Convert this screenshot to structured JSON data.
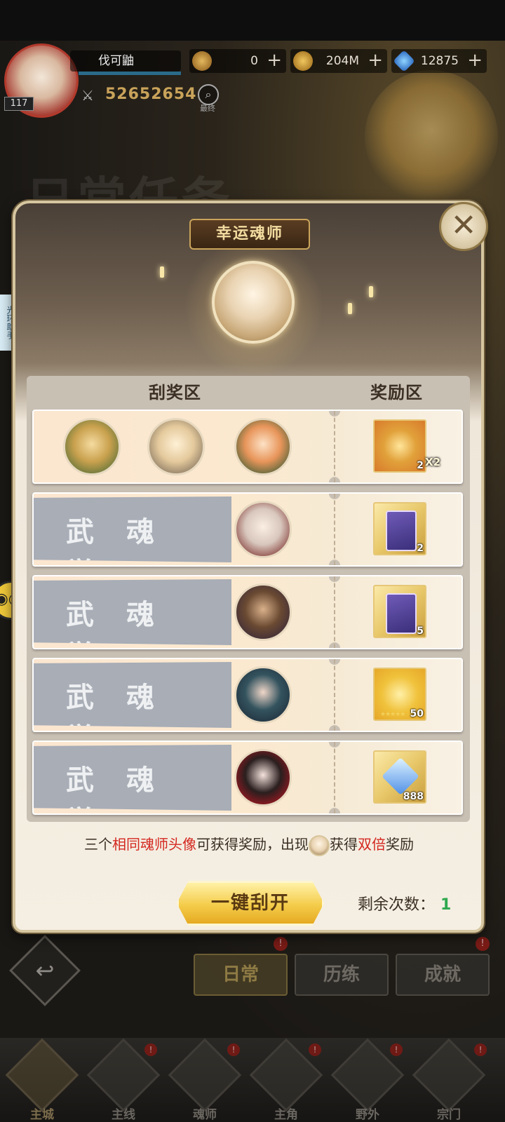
{
  "hud": {
    "player_name": "伐可鼬",
    "level": "117",
    "power": "52652654",
    "search_label": "最终",
    "resources": [
      {
        "icon": "soul-coin-icon",
        "value": "0"
      },
      {
        "icon": "gold-coin-icon",
        "value": "204M"
      },
      {
        "icon": "diamond-icon",
        "value": "12875"
      }
    ],
    "plus": "+"
  },
  "side": {
    "assistant_label": "光环助手"
  },
  "background": {
    "title": "日常任务"
  },
  "dialog": {
    "title": "幸运魂师",
    "close": "✕",
    "scratch_zone": "刮奖区",
    "reward_zone": "奖励区",
    "rows": [
      {
        "cover": "",
        "faces": [
          "green-hood-girl",
          "blonde-girl",
          "orange-hair-girl"
        ],
        "reward": "coin-icon",
        "count": "2",
        "multiplier": "X2"
      },
      {
        "cover": "武魂觉",
        "faces": [
          "silver-hair-man"
        ],
        "reward": "purple-card-icon",
        "count": "2"
      },
      {
        "cover": "武魂觉",
        "faces": [
          "bearded-man"
        ],
        "reward": "purple-card-icon",
        "count": "5"
      },
      {
        "cover": "武魂觉",
        "faces": [
          "dark-teal-hair-man"
        ],
        "reward": "gold-crystal-icon",
        "count": "50"
      },
      {
        "cover": "武魂觉",
        "faces": [
          "red-flower-woman"
        ],
        "reward": "diamond-icon",
        "count": "888"
      }
    ],
    "tip": {
      "p1": "三个",
      "p2": "相同魂师头像",
      "p3": "可获得奖励，出现",
      "p4": "获得",
      "p5": "双倍",
      "p6": "奖励"
    },
    "scratch_button": "一键刮开",
    "remaining_label": "剩余次数：",
    "remaining_value": "1"
  },
  "tabs": {
    "daily": "日常",
    "training": "历练",
    "achievement": "成就",
    "badge": "!"
  },
  "nav": [
    {
      "label": "主城"
    },
    {
      "label": "主线"
    },
    {
      "label": "魂师"
    },
    {
      "label": "主角"
    },
    {
      "label": "野外"
    },
    {
      "label": "宗门"
    }
  ],
  "colors": {
    "accent_gold": "#f4cc4a",
    "highlight_red": "#d4271f",
    "count_green": "#2fa84f"
  }
}
